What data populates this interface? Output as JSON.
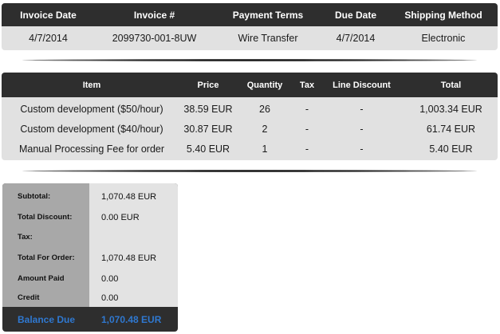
{
  "invoice_info": {
    "headers": [
      "Invoice Date",
      "Invoice #",
      "Payment Terms",
      "Due Date",
      "Shipping Method"
    ],
    "values": [
      "4/7/2014",
      "2099730-001-8UW",
      "Wire Transfer",
      "4/7/2014",
      "Electronic"
    ]
  },
  "line_items": {
    "headers": [
      "Item",
      "Price",
      "Quantity",
      "Tax",
      "Line Discount",
      "Total"
    ],
    "rows": [
      [
        "Custom development ($50/hour)",
        "38.59 EUR",
        "26",
        "-",
        "-",
        "1,003.34 EUR"
      ],
      [
        "Custom development ($40/hour)",
        "30.87 EUR",
        "2",
        "-",
        "-",
        "61.74 EUR"
      ],
      [
        "Manual Processing Fee for order",
        "5.40 EUR",
        "1",
        "-",
        "-",
        "5.40 EUR"
      ]
    ]
  },
  "totals": {
    "rows": [
      {
        "label": "Subtotal:",
        "value": "1,070.48 EUR"
      },
      {
        "label": "Total Discount:",
        "value": "0.00 EUR"
      },
      {
        "label": "Tax:",
        "value": ""
      },
      {
        "label": "Total For Order:",
        "value": "1,070.48 EUR"
      },
      {
        "label": "Amount Paid",
        "value": "0.00"
      },
      {
        "label": "Credit",
        "value": "0.00"
      }
    ],
    "balance_label": "Balance Due",
    "balance_value": "1,070.48 EUR"
  },
  "colors": {
    "header_bg": "#2e2e2e",
    "row_bg": "#e1e1e1",
    "label_col_bg": "#a8a8a8",
    "balance_accent": "#2f78d0"
  }
}
